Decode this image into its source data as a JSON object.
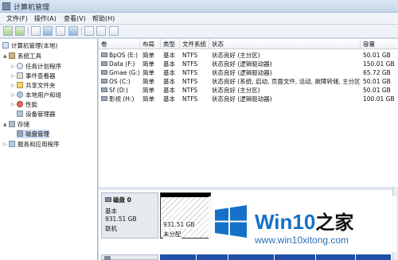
{
  "window": {
    "title": "计算机管理"
  },
  "menu": [
    "文件(F)",
    "操作(A)",
    "查看(V)",
    "帮助(H)"
  ],
  "toolbar": {
    "buttons": [
      "back-icon",
      "forward-icon",
      "up-folder-icon",
      "console-tree-icon",
      "help-icon",
      "properties-icon",
      "export-icon",
      "refresh-icon",
      "settings-icon"
    ]
  },
  "tree": {
    "items": [
      {
        "label": "计算机管理(本地)",
        "icon": "computer-icon",
        "expander": ""
      },
      {
        "label": "系统工具",
        "icon": "tools-icon",
        "expander": "▲"
      },
      {
        "label": "任务计划程序",
        "icon": "clock-icon",
        "expander": "▷"
      },
      {
        "label": "事件查看器",
        "icon": "event-icon",
        "expander": "▷"
      },
      {
        "label": "共享文件夹",
        "icon": "folder-icon",
        "expander": "▷"
      },
      {
        "label": "本地用户和组",
        "icon": "users-icon",
        "expander": "▷"
      },
      {
        "label": "性能",
        "icon": "performance-icon",
        "expander": "▷"
      },
      {
        "label": "设备管理器",
        "icon": "device-icon",
        "expander": ""
      },
      {
        "label": "存储",
        "icon": "storage-icon",
        "expander": "▲"
      },
      {
        "label": "磁盘管理",
        "icon": "disk-icon",
        "expander": ""
      },
      {
        "label": "服务和应用程序",
        "icon": "services-icon",
        "expander": "▷"
      }
    ]
  },
  "volumes": {
    "columns": [
      "卷",
      "布局",
      "类型",
      "文件系统",
      "状态",
      "容量"
    ],
    "rows": [
      [
        "BpOS (E:)",
        "简单",
        "基本",
        "NTFS",
        "状态良好 (主分区)",
        "50.01 GB"
      ],
      [
        "Data (F:)",
        "简单",
        "基本",
        "NTFS",
        "状态良好 (逻辑驱动器)",
        "150.01 GB"
      ],
      [
        "Gmae (G:)",
        "简单",
        "基本",
        "NTFS",
        "状态良好 (逻辑驱动器)",
        "65.72 GB"
      ],
      [
        "OS (C:)",
        "简单",
        "基本",
        "NTFS",
        "状态良好 (系统, 启动, 页面文件, 活动, 故障转储, 主分区)",
        "50.01 GB"
      ],
      [
        "Sf (D:)",
        "简单",
        "基本",
        "NTFS",
        "状态良好 (主分区)",
        "50.01 GB"
      ],
      [
        "影视 (H:)",
        "简单",
        "基本",
        "NTFS",
        "状态良好 (逻辑驱动器)",
        "100.01 GB"
      ]
    ]
  },
  "disk0": {
    "name": "磁盘 0",
    "type": "基本",
    "size": "931.51 GB",
    "status": "联机",
    "partition_size": "931.51 GB",
    "partition_label": "未分配"
  },
  "watermark": {
    "brand": "Win10",
    "suffix": "之家",
    "url": "www.win10xitong.com"
  }
}
